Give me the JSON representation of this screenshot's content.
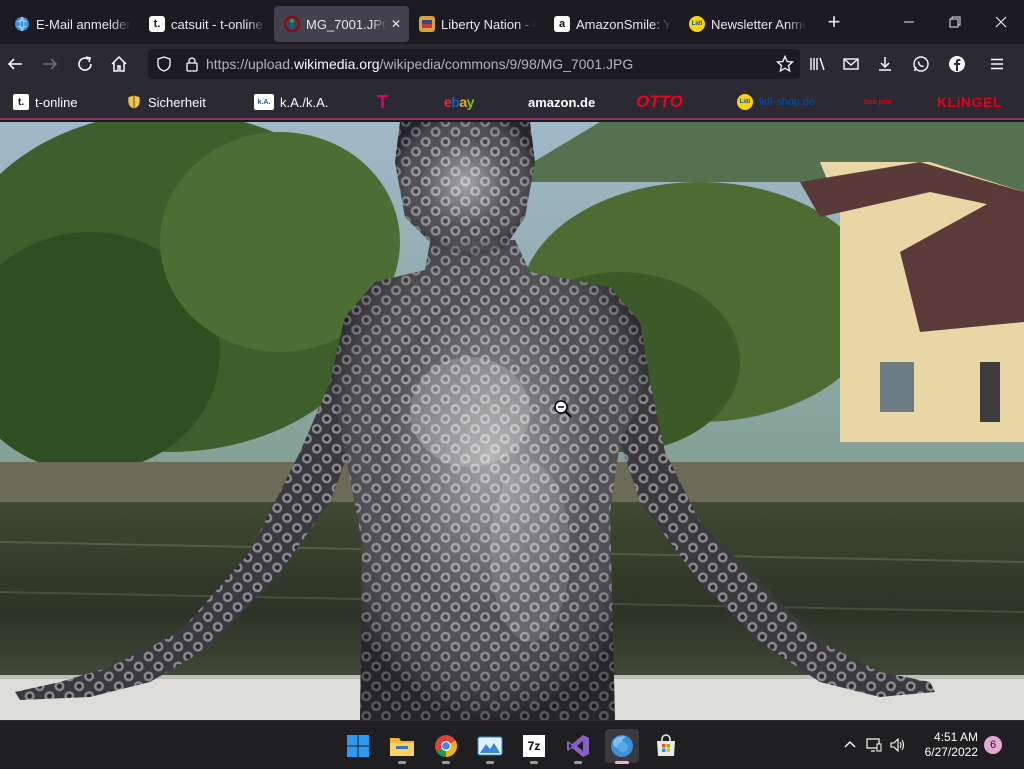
{
  "tabs": [
    {
      "title": "E-Mail anmelden",
      "favicon": "globe-icon"
    },
    {
      "title": "catsuit - t-online",
      "favicon": "t-online-icon",
      "favicon_text": "t."
    },
    {
      "title": "MG_7001.JPG",
      "favicon": "wikimedia-icon",
      "active": true
    },
    {
      "title": "Liberty Nation - C",
      "favicon": "liberty-nation-icon"
    },
    {
      "title": "AmazonSmile: Yo",
      "favicon": "amazon-icon",
      "favicon_text": "a"
    },
    {
      "title": "Newsletter Anme",
      "favicon": "lidl-icon",
      "favicon_text": "Lidl"
    }
  ],
  "url": {
    "prefix": "https://upload.",
    "domain": "wikimedia.org",
    "path": "/wikipedia/commons/9/98/MG_7001.JPG"
  },
  "bookmarks": [
    {
      "label": "t-online",
      "favicon_text": "t."
    },
    {
      "label": "Sicherheit",
      "favicon": "shield-icon"
    },
    {
      "label": "k.A./k.A.",
      "favicon_text": "k.A."
    },
    {
      "label": "T",
      "favicon": "telekom-logo"
    },
    {
      "label": "ebay",
      "favicon": "ebay-logo"
    },
    {
      "label": "amazon.de",
      "favicon": "amazon-logo"
    },
    {
      "label": "OTTO",
      "favicon": "otto-logo"
    },
    {
      "label": "lidl-shop.de",
      "favicon_text": "Lidl"
    },
    {
      "label": "bon prix",
      "favicon": "bonprix-logo"
    },
    {
      "label": "KLiNGEL",
      "favicon": "klingel-logo"
    }
  ],
  "taskbar": {
    "apps": [
      "start-icon",
      "file-explorer-icon",
      "chrome-icon",
      "photos-icon",
      "7zip-icon",
      "visual-studio-icon",
      "firefox-icon",
      "store-icon"
    ],
    "zip_label": "7z"
  },
  "tray": {
    "time": "4:51 AM",
    "date": "6/27/2022",
    "notifications": "6"
  },
  "colors": {
    "accent": "#9c2d5a",
    "tab_bg": "#1c1b22",
    "toolbar_bg": "#2b2a33",
    "active_tab": "#42414d",
    "taskbar": "#1f1f21",
    "notification_badge": "#e3a8d4"
  }
}
